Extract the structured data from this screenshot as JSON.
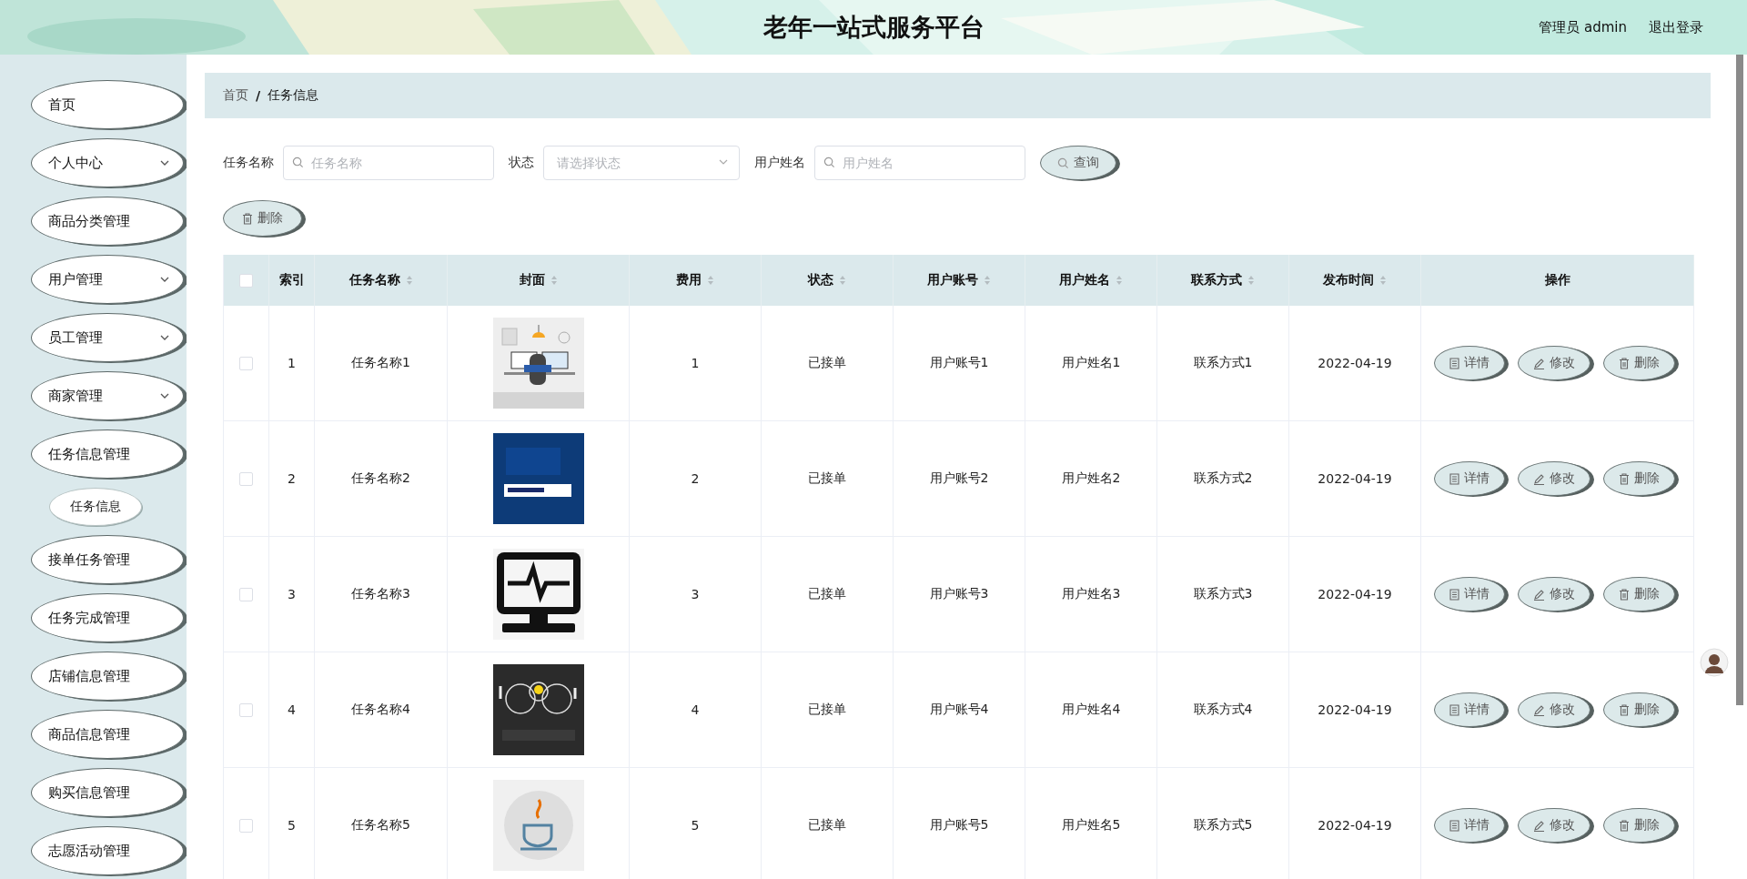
{
  "header": {
    "title": "老年一站式服务平台",
    "user": "管理员 admin",
    "logout": "退出登录"
  },
  "sidebar": {
    "items": [
      {
        "label": "首页",
        "kind": "link"
      },
      {
        "label": "个人中心",
        "kind": "submenu",
        "expanded": false
      },
      {
        "label": "商品分类管理",
        "kind": "link"
      },
      {
        "label": "用户管理",
        "kind": "submenu",
        "expanded": false
      },
      {
        "label": "员工管理",
        "kind": "submenu",
        "expanded": false
      },
      {
        "label": "商家管理",
        "kind": "submenu",
        "expanded": false
      },
      {
        "label": "任务信息管理",
        "kind": "submenu",
        "expanded": true,
        "children": [
          {
            "label": "任务信息"
          }
        ]
      },
      {
        "label": "接单任务管理",
        "kind": "link"
      },
      {
        "label": "任务完成管理",
        "kind": "link"
      },
      {
        "label": "店铺信息管理",
        "kind": "link"
      },
      {
        "label": "商品信息管理",
        "kind": "link"
      },
      {
        "label": "购买信息管理",
        "kind": "link"
      },
      {
        "label": "志愿活动管理",
        "kind": "link"
      }
    ]
  },
  "breadcrumb": [
    {
      "label": "首页"
    },
    {
      "label": "/"
    },
    {
      "label": "任务信息"
    }
  ],
  "search": {
    "fields": [
      {
        "label": "任务名称",
        "placeholder": "任务名称",
        "kind": "text"
      },
      {
        "label": "状态",
        "placeholder": "请选择状态",
        "kind": "select"
      },
      {
        "label": "用户姓名",
        "placeholder": "用户姓名",
        "kind": "text"
      }
    ],
    "button": "查询"
  },
  "toolbar": {
    "delete": "删除"
  },
  "table": {
    "select_all": false,
    "columns": [
      {
        "label": "索引",
        "sortable": false
      },
      {
        "label": "任务名称",
        "sortable": true
      },
      {
        "label": "封面",
        "sortable": true
      },
      {
        "label": "费用",
        "sortable": true
      },
      {
        "label": "状态",
        "sortable": true
      },
      {
        "label": "用户账号",
        "sortable": true
      },
      {
        "label": "用户姓名",
        "sortable": true
      },
      {
        "label": "联系方式",
        "sortable": true
      },
      {
        "label": "发布时间",
        "sortable": true
      },
      {
        "label": "操作",
        "sortable": false
      }
    ],
    "rows": [
      {
        "checked": false,
        "cells": [
          "1",
          "任务名称1",
          {
            "kind": "picture"
          },
          "1",
          "已接单",
          "用户账号1",
          "用户姓名1",
          "联系方式1",
          "2022-04-19"
        ],
        "actions": [
          {
            "label": "详情",
            "kind": "detail"
          },
          {
            "label": "修改",
            "kind": "edit"
          },
          {
            "label": "删除",
            "kind": "delete"
          }
        ]
      },
      {
        "checked": false,
        "cells": [
          "2",
          "任务名称2",
          {
            "kind": "picture"
          },
          "2",
          "已接单",
          "用户账号2",
          "用户姓名2",
          "联系方式2",
          "2022-04-19"
        ],
        "actions": [
          {
            "label": "详情",
            "kind": "detail"
          },
          {
            "label": "修改",
            "kind": "edit"
          },
          {
            "label": "删除",
            "kind": "delete"
          }
        ]
      },
      {
        "checked": false,
        "cells": [
          "3",
          "任务名称3",
          {
            "kind": "picture"
          },
          "3",
          "已接单",
          "用户账号3",
          "用户姓名3",
          "联系方式3",
          "2022-04-19"
        ],
        "actions": [
          {
            "label": "详情",
            "kind": "detail"
          },
          {
            "label": "修改",
            "kind": "edit"
          },
          {
            "label": "删除",
            "kind": "delete"
          }
        ]
      },
      {
        "checked": false,
        "cells": [
          "4",
          "任务名称4",
          {
            "kind": "picture"
          },
          "4",
          "已接单",
          "用户账号4",
          "用户姓名4",
          "联系方式4",
          "2022-04-19"
        ],
        "actions": [
          {
            "label": "详情",
            "kind": "detail"
          },
          {
            "label": "修改",
            "kind": "edit"
          },
          {
            "label": "删除",
            "kind": "delete"
          }
        ]
      },
      {
        "checked": false,
        "cells": [
          "5",
          "任务名称5",
          {
            "kind": "picture"
          },
          "5",
          "已接单",
          "用户账号5",
          "用户姓名5",
          "联系方式5",
          "2022-04-19"
        ],
        "actions": [
          {
            "label": "详情",
            "kind": "detail"
          },
          {
            "label": "修改",
            "kind": "edit"
          },
          {
            "label": "删除",
            "kind": "delete"
          }
        ]
      }
    ]
  }
}
